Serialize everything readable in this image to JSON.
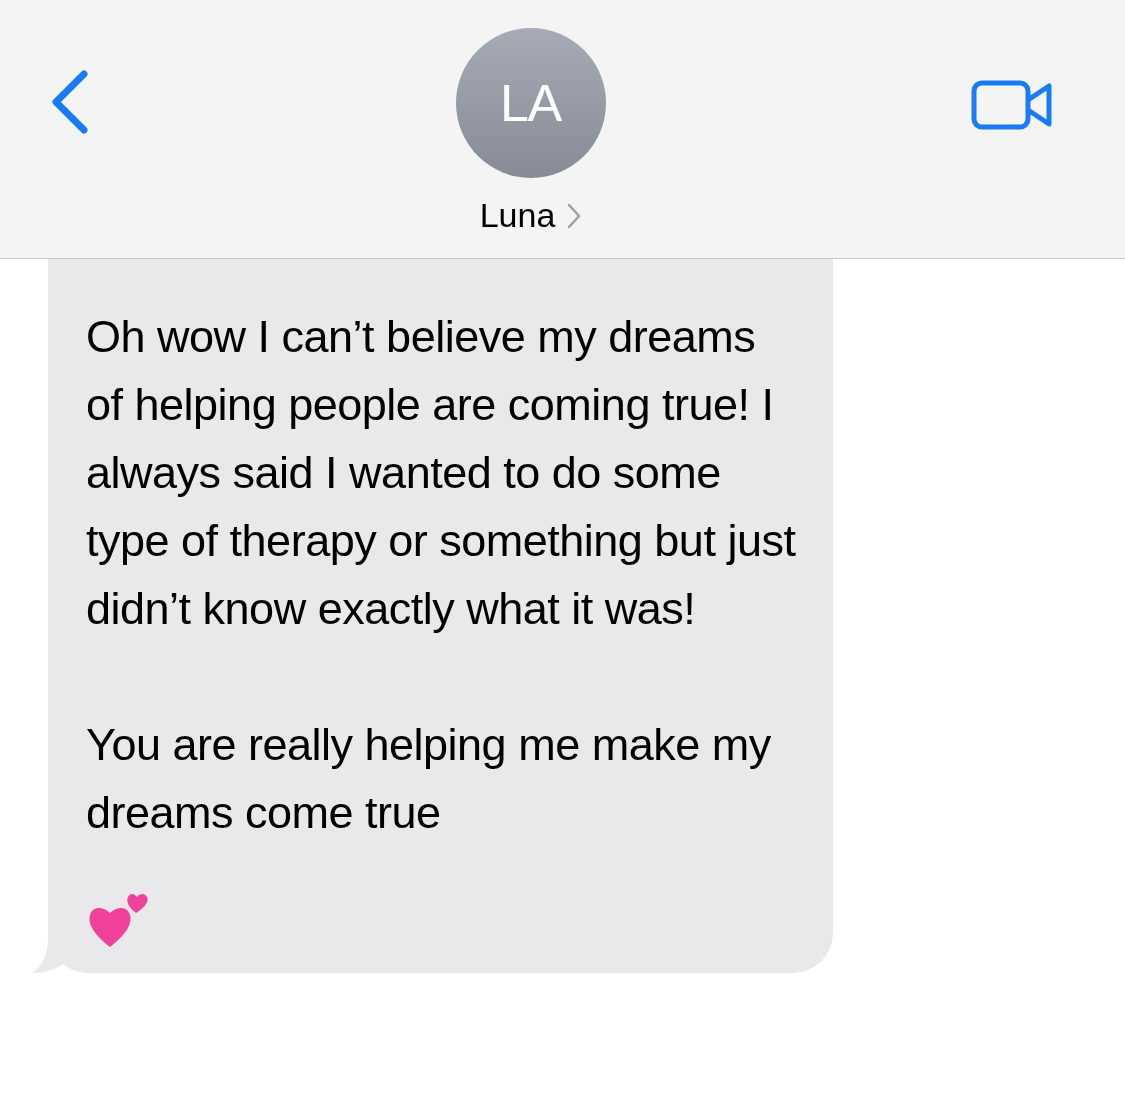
{
  "header": {
    "avatar_initials": "LA",
    "contact_name": "Luna"
  },
  "message": {
    "paragraphs": [
      "Oh wow I can’t believe my dreams of helping people are coming true! I always said I wanted to do some type of therapy or something but just didn’t know exactly what it was!",
      "You are really helping me make my dreams come true"
    ],
    "kind": "received"
  }
}
